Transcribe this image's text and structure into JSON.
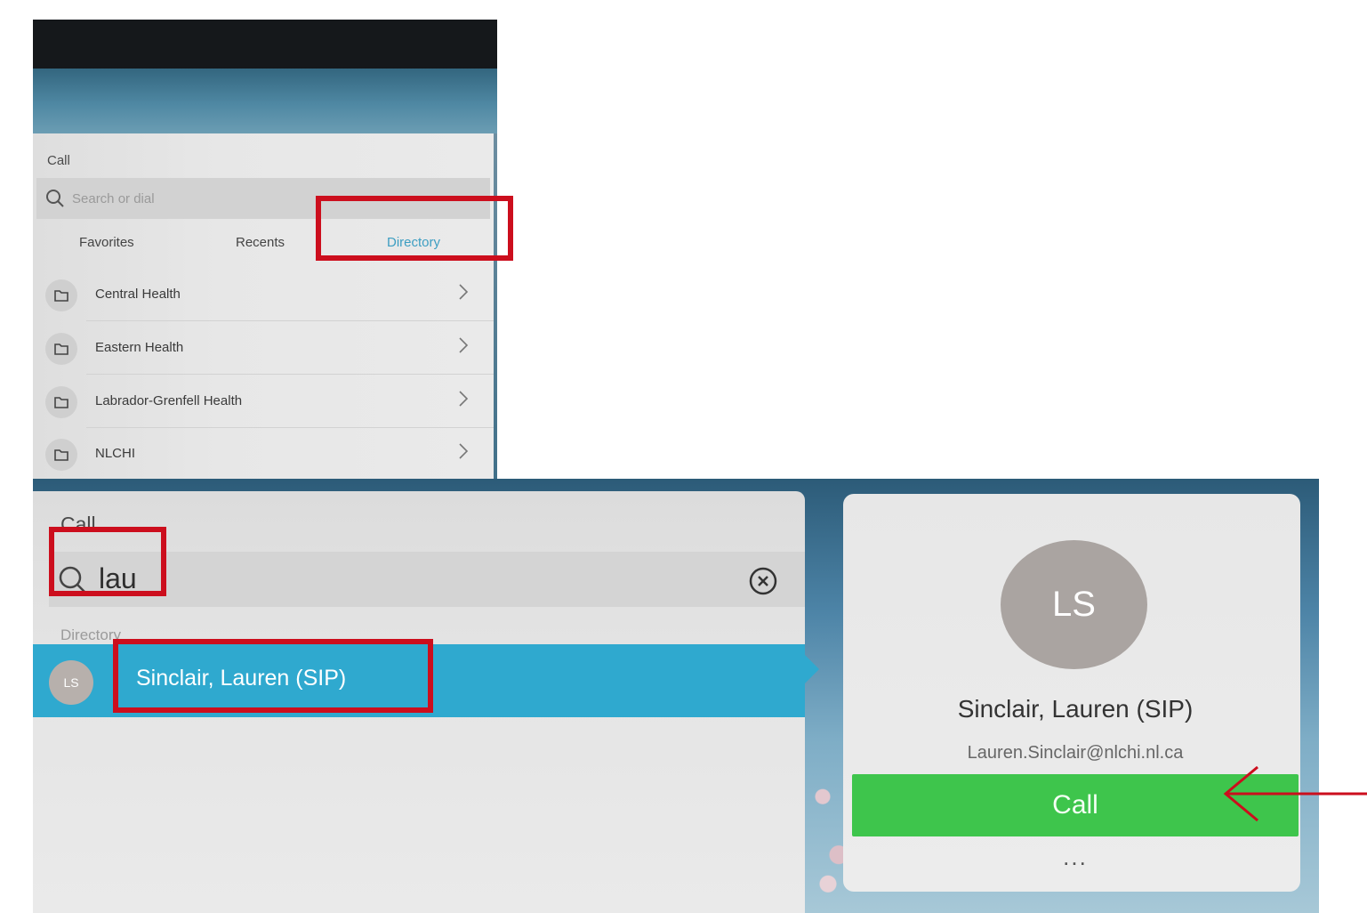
{
  "top_panel": {
    "title": "Call",
    "search_placeholder": "Search or dial",
    "tabs": [
      {
        "label": "Favorites"
      },
      {
        "label": "Recents"
      },
      {
        "label": "Directory"
      }
    ],
    "directory_items": [
      {
        "label": "Central Health"
      },
      {
        "label": "Eastern Health"
      },
      {
        "label": "Labrador-Grenfell Health"
      },
      {
        "label": "NLCHI"
      }
    ]
  },
  "bottom_panel": {
    "title": "Call",
    "search_value": "lau",
    "section_label": "Directory",
    "result": {
      "initials": "LS",
      "name": "Sinclair, Lauren (SIP)"
    },
    "contact_card": {
      "initials": "LS",
      "name": "Sinclair, Lauren (SIP)",
      "email": "Lauren.Sinclair@nlchi.nl.ca",
      "call_label": "Call",
      "more_label": "..."
    }
  },
  "annotations": {
    "highlight_color": "#cc0e1d"
  }
}
